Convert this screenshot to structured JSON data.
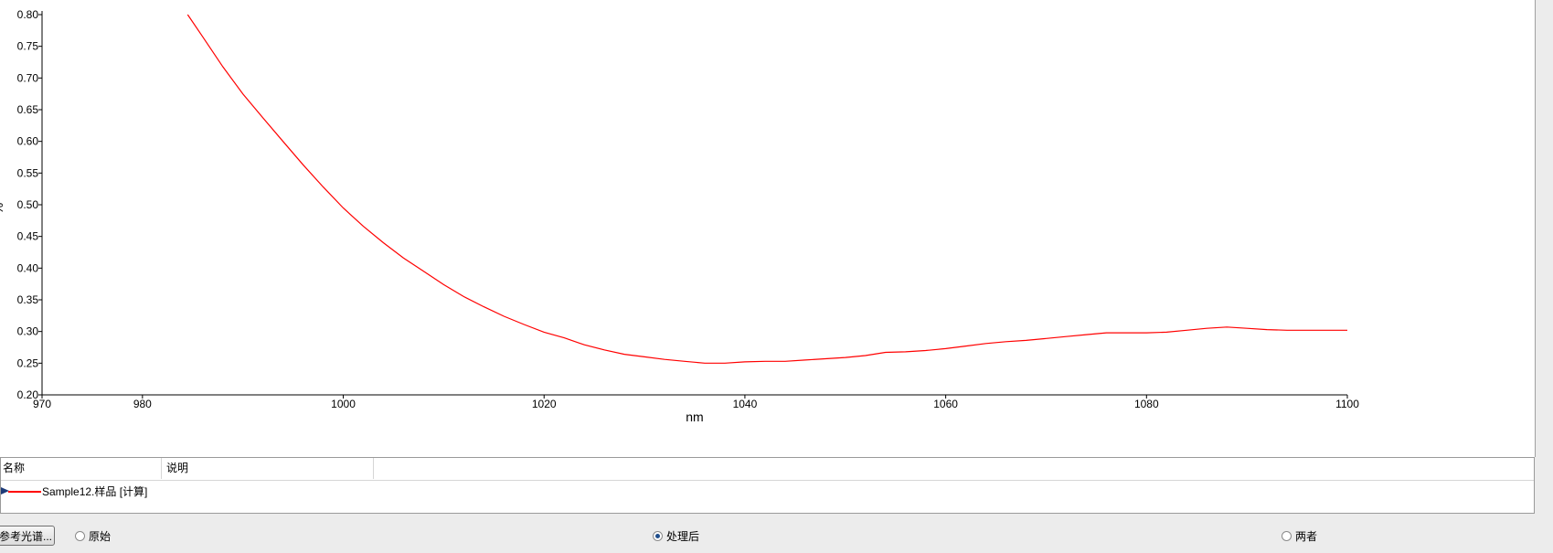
{
  "chart_data": {
    "type": "line",
    "xlabel": "nm",
    "ylabel": "%",
    "xlim": [
      970,
      1100
    ],
    "ylim": [
      0.2,
      0.8
    ],
    "x_ticks": [
      970,
      980,
      1000,
      1020,
      1040,
      1060,
      1080,
      1100
    ],
    "y_ticks": [
      "0.20",
      "0.25",
      "0.30",
      "0.35",
      "0.40",
      "0.45",
      "0.50",
      "0.55",
      "0.60",
      "0.65",
      "0.70",
      "0.75",
      "0.80"
    ],
    "series": [
      {
        "name": "Sample12.样品 [计算]",
        "color": "#ff0000",
        "x": [
          984.5,
          986,
          988,
          990,
          992,
          994,
          996,
          998,
          1000,
          1002,
          1004,
          1006,
          1008,
          1010,
          1012,
          1014,
          1016,
          1018,
          1020,
          1022,
          1024,
          1026,
          1028,
          1030,
          1032,
          1034,
          1036,
          1038,
          1040,
          1042,
          1044,
          1046,
          1048,
          1050,
          1052,
          1054,
          1056,
          1058,
          1060,
          1062,
          1064,
          1066,
          1068,
          1070,
          1072,
          1074,
          1076,
          1078,
          1080,
          1082,
          1084,
          1086,
          1088,
          1090,
          1092,
          1094,
          1096,
          1098,
          1100
        ],
        "y": [
          0.8,
          0.765,
          0.718,
          0.675,
          0.637,
          0.6,
          0.563,
          0.528,
          0.495,
          0.466,
          0.44,
          0.416,
          0.395,
          0.374,
          0.355,
          0.339,
          0.324,
          0.311,
          0.299,
          0.29,
          0.279,
          0.271,
          0.264,
          0.26,
          0.256,
          0.253,
          0.25,
          0.25,
          0.252,
          0.253,
          0.253,
          0.255,
          0.257,
          0.259,
          0.262,
          0.267,
          0.268,
          0.27,
          0.273,
          0.277,
          0.281,
          0.284,
          0.286,
          0.289,
          0.292,
          0.295,
          0.298,
          0.298,
          0.298,
          0.299,
          0.302,
          0.305,
          0.307,
          0.305,
          0.303,
          0.302,
          0.302,
          0.302,
          0.302
        ]
      }
    ]
  },
  "legend": {
    "col_name": "名称",
    "col_desc": "说明",
    "series_label": "Sample12.样品 [计算]",
    "line_color": "#ff0000"
  },
  "bottom": {
    "ref_button": "参考光谱...",
    "radio_original": "原始",
    "radio_processed": "处理后",
    "radio_both": "两者",
    "selected": "处理后"
  }
}
